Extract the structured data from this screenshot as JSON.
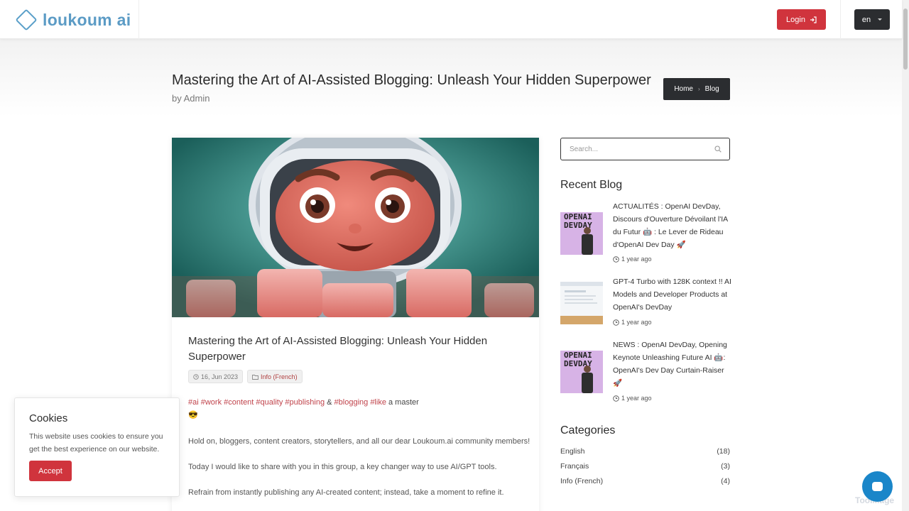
{
  "header": {
    "logo_text": "loukoum ai",
    "login_label": "Login",
    "language": "en"
  },
  "page": {
    "title": "Mastering the Art of AI-Assisted Blogging: Unleash Your Hidden Superpower",
    "byline": "by Admin",
    "breadcrumb": [
      "Home",
      "Blog"
    ]
  },
  "post": {
    "title": "Mastering the Art of AI-Assisted Blogging: Unleash Your Hidden Superpower",
    "date": "16, Jun 2023",
    "category": "Info (French)",
    "tags": [
      "#ai",
      "#work",
      "#content",
      "#quality",
      "#publishing",
      "&",
      "#blogging",
      "#like",
      "a master"
    ],
    "emoji": "😎",
    "paragraphs": [
      "Hold on, bloggers, content creators, storytellers, and all our dear Loukoum.ai community members!",
      "Today I would like to share with you in this group, a key changer way to use AI/GPT tools.",
      "Refrain from instantly publishing any AI-created content; instead, take a moment to refine it."
    ]
  },
  "sidebar": {
    "search_placeholder": "Search...",
    "recent_title": "Recent Blog",
    "recent": [
      {
        "title": "ACTUALITÉS : OpenAI DevDay, Discours d'Ouverture Dévoilant l'IA du Futur 🤖 : Le Lever de Rideau d'OpenAI Dev Day 🚀",
        "ago": "1 year ago",
        "thumb_text": "OPENAI DEVDAY"
      },
      {
        "title": "GPT-4 Turbo with 128K context !! AI Models and Developer Products at OpenAI's DevDay",
        "ago": "1 year ago",
        "thumb_text": ""
      },
      {
        "title": "NEWS : OpenAI DevDay, Opening Keynote Unleashing Future AI 🤖: OpenAI's Dev Day Curtain-Raiser 🚀",
        "ago": "1 year ago",
        "thumb_text": "OPENAI DEVDAY"
      }
    ],
    "categories_title": "Categories",
    "categories": [
      {
        "name": "English",
        "count": "(18)"
      },
      {
        "name": "Français",
        "count": "(3)"
      },
      {
        "name": "Info (French)",
        "count": "(4)"
      }
    ]
  },
  "cookie": {
    "title": "Cookies",
    "text": "This website uses cookies to ensure you get the best experience on our website.",
    "accept_label": "Accept"
  },
  "watermark": "ToolMage",
  "colors": {
    "accent_red": "#d0343d",
    "dark": "#2b2d30",
    "brand_blue": "#5b9bc5",
    "chat_blue": "#1a86c9"
  }
}
